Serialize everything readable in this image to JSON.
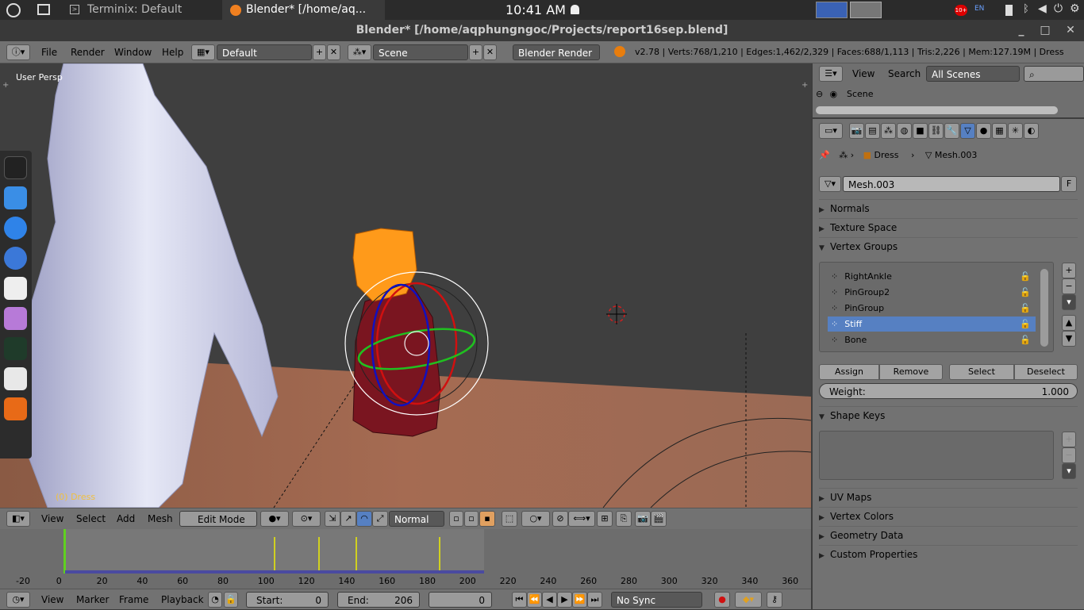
{
  "system_bar": {
    "tab1": "Terminix: Default",
    "tab2": "Blender* [/home/aq...",
    "clock": "10:41 AM",
    "lang": "EN",
    "notif_count": "10+"
  },
  "window_title": "Blender* [/home/aqphungngoc/Projects/report16sep.blend]",
  "info_header": {
    "menus": [
      "File",
      "Render",
      "Window",
      "Help"
    ],
    "layout": "Default",
    "scene": "Scene",
    "engine": "Blender Render",
    "stats": "v2.78 | Verts:768/1,210 | Edges:1,462/2,329 | Faces:688/1,113 | Tris:2,226 | Mem:127.19M | Dress"
  },
  "viewport": {
    "view_label": "User Persp",
    "object_label": "(0) Dress"
  },
  "view3d_header": {
    "menus": [
      "View",
      "Select",
      "Add",
      "Mesh"
    ],
    "mode": "Edit Mode",
    "pivot": "Normal"
  },
  "timeline": {
    "ticks": [
      "-20",
      "0",
      "20",
      "40",
      "60",
      "80",
      "100",
      "120",
      "140",
      "160",
      "180",
      "200",
      "220",
      "240",
      "260",
      "280",
      "300",
      "320",
      "340",
      "360"
    ],
    "menus": [
      "View",
      "Marker",
      "Frame",
      "Playback"
    ],
    "start_label": "Start:",
    "start": "0",
    "end_label": "End:",
    "end": "206",
    "current": "0",
    "sync": "No Sync"
  },
  "outliner": {
    "menus": [
      "View",
      "Search"
    ],
    "filter": "All Scenes",
    "root": "Scene"
  },
  "properties": {
    "breadcrumb_object": "Dress",
    "breadcrumb_mesh": "Mesh.003",
    "datablock": "Mesh.003",
    "fake_user": "F",
    "panels_top": [
      "Normals",
      "Texture Space"
    ],
    "vertex_groups_title": "Vertex Groups",
    "vertex_groups": [
      "RightAnkle",
      "PinGroup2",
      "PinGroup",
      "Stiff",
      "Bone"
    ],
    "selected_group": "Stiff",
    "buttons": [
      "Assign",
      "Remove",
      "Select",
      "Deselect"
    ],
    "weight_label": "Weight:",
    "weight_value": "1.000",
    "shape_keys_title": "Shape Keys",
    "panels_bottom": [
      "UV Maps",
      "Vertex Colors",
      "Geometry Data",
      "Custom Properties"
    ]
  },
  "colors": {
    "selection_blue": "#5680c2",
    "orange_mesh": "#ff9a1a",
    "dress_red": "#8a1a1f"
  }
}
